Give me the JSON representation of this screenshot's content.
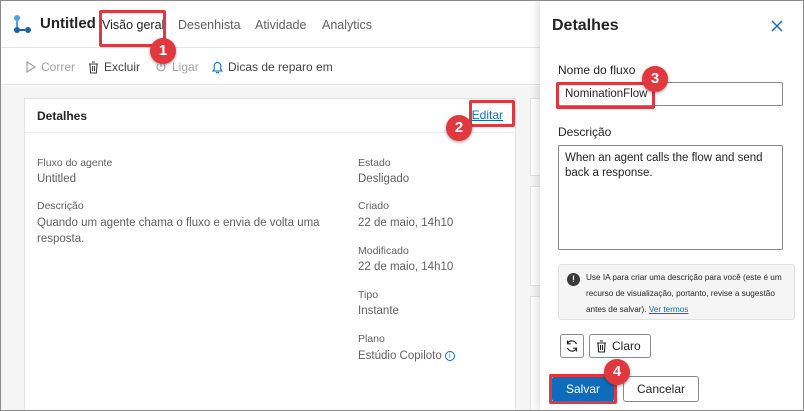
{
  "app": {
    "title": "Untitled"
  },
  "tabs": [
    {
      "label": "Visão geral"
    },
    {
      "label": "Desenhista"
    },
    {
      "label": "Atividade"
    },
    {
      "label": "Analytics"
    }
  ],
  "toolbar": {
    "run": "Correr",
    "delete": "Excluir",
    "connect": "Ligar",
    "repair_tips": "Dicas de reparo em"
  },
  "details_card": {
    "title": "Detalhes",
    "edit_link": "Editar",
    "left": [
      {
        "label": "Fluxo do agente",
        "value": "Untitled"
      },
      {
        "label": "Descrição",
        "value": "Quando um agente chama o fluxo e envia de volta uma resposta."
      }
    ],
    "right": [
      {
        "label": "Estado",
        "value": "Desligado"
      },
      {
        "label": "Criado",
        "value": "22 de maio, 14h10"
      },
      {
        "label": "Modificado",
        "value": "22 de maio, 14h10"
      },
      {
        "label": "Tipo",
        "value": "Instante"
      },
      {
        "label": "Plano",
        "value": "Estúdio Copiloto"
      }
    ]
  },
  "panel": {
    "title": "Detalhes",
    "name_label": "Nome do fluxo",
    "name_value": "NominationFlow",
    "desc_label": "Descrição",
    "desc_value": "When an agent calls the flow and send back a response.",
    "notice_text": "Use IA para criar uma descrição para você (este é um recurso de visualização, portanto, revise a sugestão antes de salvar).",
    "notice_link": "Ver termos",
    "clear_label": "Claro",
    "save_label": "Salvar",
    "cancel_label": "Cancelar"
  },
  "callouts": [
    "1",
    "2",
    "3",
    "4"
  ],
  "colors": {
    "accent": "#0f6cbd",
    "callout": "#e0383e"
  }
}
